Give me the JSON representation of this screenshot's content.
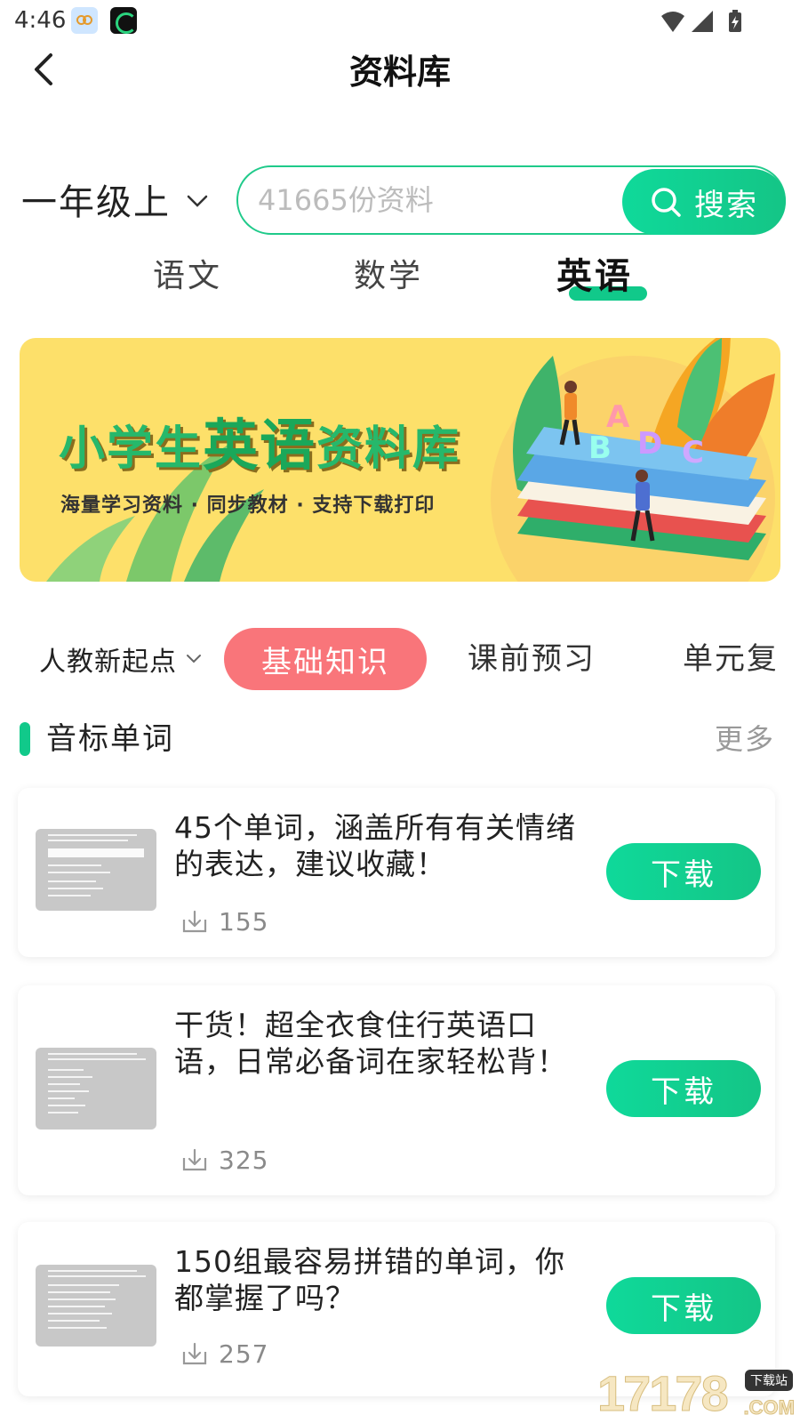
{
  "status_bar": {
    "time": "4:46",
    "icons": [
      "wifi-icon",
      "signal-icon",
      "battery-icon"
    ]
  },
  "header": {
    "title": "资料库"
  },
  "grade": {
    "label": "一年级上"
  },
  "search": {
    "placeholder": "41665份资料",
    "button_label": "搜索"
  },
  "subject_tabs": [
    {
      "label": "语文",
      "active": false
    },
    {
      "label": "数学",
      "active": false
    },
    {
      "label": "英语",
      "active": true
    }
  ],
  "banner": {
    "title_prefix": "小学生",
    "title_highlight": "英语",
    "title_suffix": "资料库",
    "subtitle": "海量学习资料 · 同步教材 · 支持下载打印"
  },
  "category_row": {
    "edition": "人教新起点",
    "tabs": [
      {
        "label": "基础知识",
        "active": true
      },
      {
        "label": "课前预习",
        "active": false
      },
      {
        "label": "单元复",
        "active": false
      }
    ]
  },
  "section": {
    "title": "音标单词",
    "more": "更多"
  },
  "items": [
    {
      "title": "45个单词，涵盖所有有关情绪的表达，建议收藏！",
      "downloads": "155",
      "button": "下载"
    },
    {
      "title": "干货！超全衣食住行英语口语，日常必备词在家轻松背！",
      "downloads": "325",
      "button": "下载"
    },
    {
      "title": "150组最容易拼错的单词，你都掌握了吗？",
      "downloads": "257",
      "button": "下载"
    }
  ],
  "watermark": {
    "text": "17178",
    "tag": "下载站",
    "suffix": ".COM"
  },
  "colors": {
    "accent": "#11c98a",
    "active_category": "#f9757a",
    "banner_bg": "#fde06a"
  }
}
